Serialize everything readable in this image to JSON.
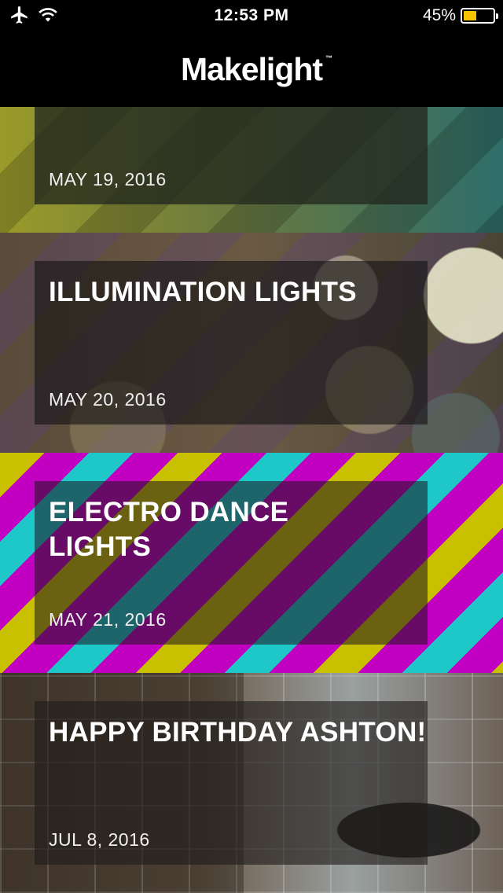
{
  "status_bar": {
    "time": "12:53 PM",
    "battery_percent": "45%",
    "battery_level": 0.45,
    "icons": [
      "airplane-icon",
      "wifi-icon",
      "battery-icon"
    ],
    "battery_color": "#f5c400"
  },
  "nav": {
    "logo": "Makelight",
    "trademark": "™"
  },
  "cards": [
    {
      "title": "",
      "date": "MAY 19, 2016"
    },
    {
      "title": "ILLUMINATION LIGHTS",
      "date": "MAY 20, 2016"
    },
    {
      "title": "ELECTRO DANCE LIGHTS",
      "date": "MAY 21, 2016"
    },
    {
      "title": "HAPPY BIRTHDAY ASHTON!",
      "date": "JUL 8, 2016"
    }
  ]
}
